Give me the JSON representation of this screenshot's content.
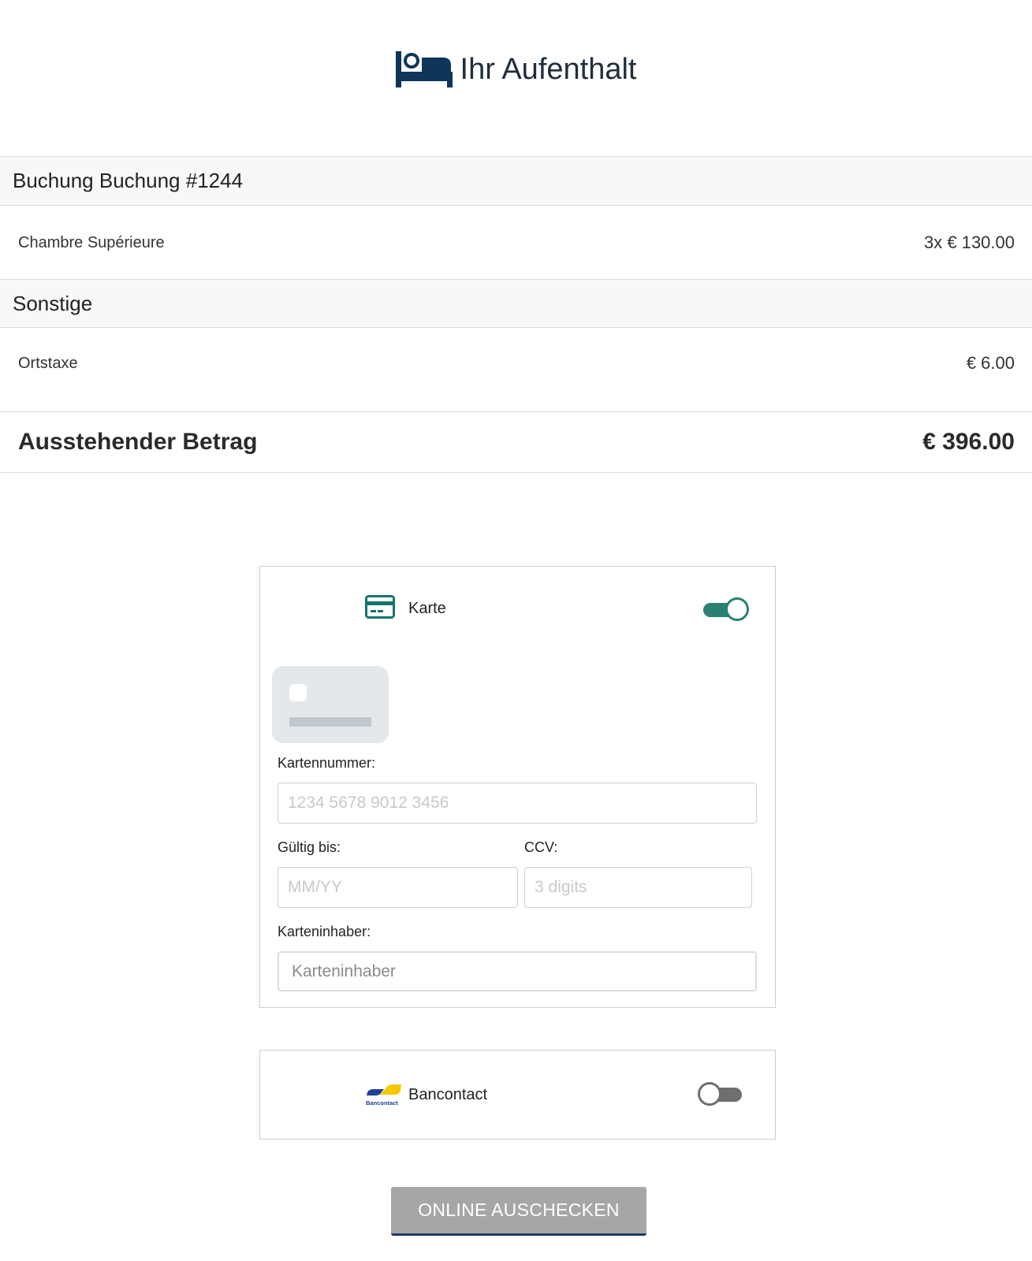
{
  "header": {
    "title": "Ihr Aufenthalt",
    "icon": "bed-icon",
    "icon_color": "#0f3558"
  },
  "booking": {
    "section_title": "Buchung Buchung #1244",
    "items": [
      {
        "name": "Chambre Supérieure",
        "price": "3x € 130.00"
      }
    ]
  },
  "other": {
    "section_title": "Sonstige",
    "items": [
      {
        "name": "Ortstaxe",
        "price": "€ 6.00"
      }
    ]
  },
  "total": {
    "label": "Ausstehender Betrag",
    "amount": "€ 396.00"
  },
  "payment": {
    "card": {
      "label": "Karte",
      "icon": "credit-card-icon",
      "enabled": true,
      "number_label": "Kartennummer:",
      "number_placeholder": "1234 5678 9012 3456",
      "expiry_label": "Gültig bis:",
      "expiry_placeholder": "MM/YY",
      "ccv_label": "CCV:",
      "ccv_placeholder": "3 digits",
      "holder_label": "Karteninhaber:",
      "holder_placeholder": "Karteninhaber"
    },
    "bancontact": {
      "label": "Bancontact",
      "icon": "bancontact-logo-icon",
      "logo_text": "Bancontact",
      "enabled": false
    }
  },
  "checkout_button": "ONLINE AUSCHECKEN",
  "colors": {
    "accent": "#2a8172",
    "toggle_off": "#6f6f6f",
    "button_bg": "#a6a6a6",
    "button_border": "#1d3a66",
    "section_bg": "#f8f8f8"
  }
}
